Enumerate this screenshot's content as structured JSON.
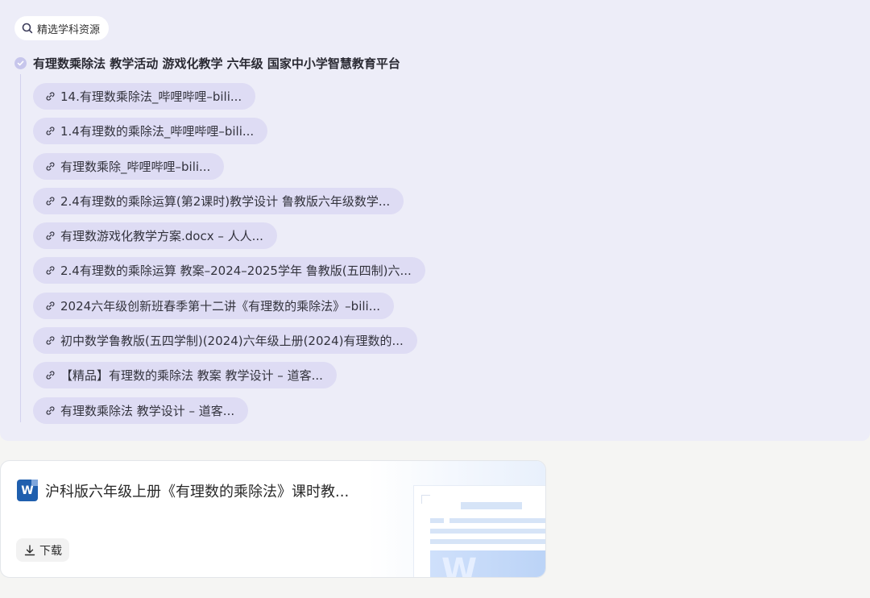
{
  "panel": {
    "chip_label": "精选学科资源",
    "section_title": "有理数乘除法 教学活动 游戏化教学 六年级 国家中小学智慧教育平台",
    "links": [
      "14.有理数乘除法_哔哩哔哩–bili...",
      "1.4有理数的乘除法_哔哩哔哩–bili...",
      "有理数乘除_哔哩哔哩–bili...",
      "2.4有理数的乘除运算(第2课时)教学设计 鲁教版六年级数学...",
      "有理数游戏化教学方案.docx – 人人...",
      "2.4有理数的乘除运算 教案–2024–2025学年 鲁教版(五四制)六...",
      "2024六年级创新班春季第十二讲《有理数的乘除法》–bili...",
      "初中数学鲁教版(五四学制)(2024)六年级上册(2024)有理数的...",
      "【精品】有理数的乘除法 教案 教学设计 – 道客...",
      "有理数乘除法 教学设计 – 道客..."
    ]
  },
  "doc_card": {
    "title": "沪科版六年级上册《有理数的乘除法》课时教...",
    "icon_letter": "W",
    "download_label": "下载"
  },
  "colors": {
    "panel_bg": "#ededf8",
    "pill_bg": "#dedcf4",
    "word_blue": "#1f5fae"
  }
}
